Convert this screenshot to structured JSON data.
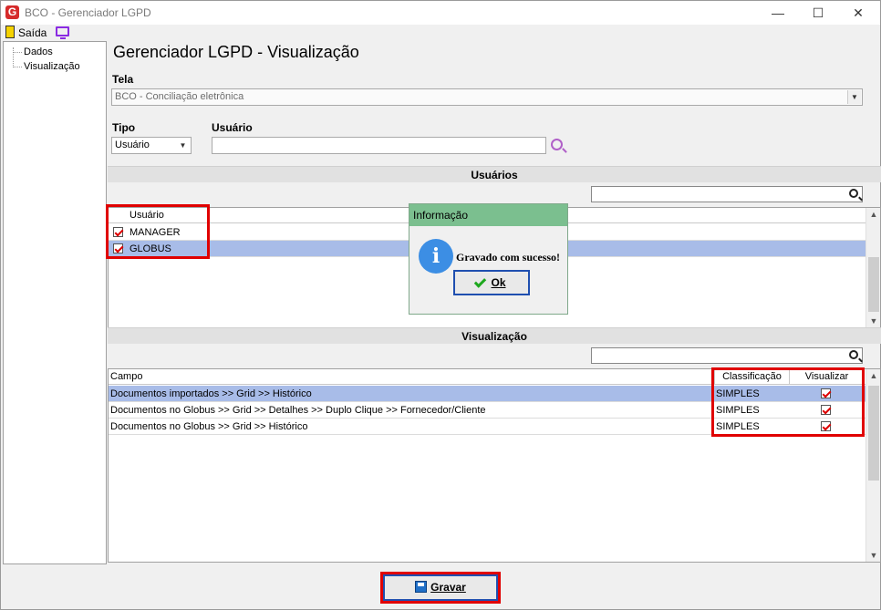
{
  "window": {
    "title": "BCO - Gerenciador LGPD",
    "minimize": "—",
    "maximize": "☐",
    "close": "✕"
  },
  "menu": {
    "exit_label": "Saída"
  },
  "tree": {
    "items": [
      "Dados",
      "Visualização"
    ]
  },
  "page_title": "Gerenciador LGPD - Visualização",
  "tela": {
    "label": "Tela",
    "value": "BCO - Conciliação eletrônica"
  },
  "tipo": {
    "label": "Tipo",
    "value": "Usuário"
  },
  "usuario_filter": {
    "label": "Usuário",
    "value": ""
  },
  "usuarios_section": {
    "title": "Usuários",
    "column": "Usuário",
    "rows": [
      {
        "name": "MANAGER",
        "checked": true
      },
      {
        "name": "GLOBUS",
        "checked": true,
        "selected": true
      }
    ]
  },
  "visualizacao_section": {
    "title": "Visualização",
    "columns": [
      "Campo",
      "Classificação",
      "Visualizar"
    ],
    "rows": [
      {
        "campo": "Documentos importados >> Grid >> Histórico",
        "classificacao": "SIMPLES",
        "visualizar": true,
        "selected": true
      },
      {
        "campo": "Documentos no Globus >> Grid >> Detalhes >> Duplo Clique >> Fornecedor/Cliente",
        "classificacao": "SIMPLES",
        "visualizar": true
      },
      {
        "campo": "Documentos no Globus >> Grid >> Histórico",
        "classificacao": "SIMPLES",
        "visualizar": true
      }
    ]
  },
  "dialog": {
    "title": "Informação",
    "message": "Gravado com sucesso!",
    "ok_label": "Ok"
  },
  "gravar_label": "Gravar",
  "colors": {
    "selection": "#a8bce8",
    "dialog_title": "#7bbf8f",
    "highlight_box": "#e00000",
    "info_icon": "#3c8ee4"
  }
}
